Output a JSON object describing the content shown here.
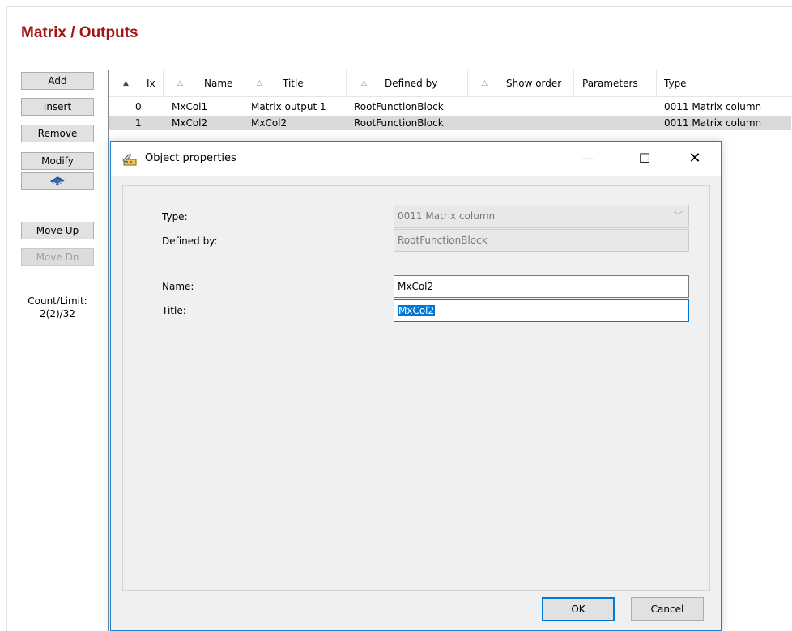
{
  "page": {
    "title": "Matrix / Outputs"
  },
  "sidebar": {
    "add_label": "Add",
    "insert_label": "Insert",
    "remove_label": "Remove",
    "modify_label": "Modify",
    "help_icon": "book-icon",
    "move_up_label": "Move Up",
    "move_dn_label": "Move Dn",
    "count_label": "Count/Limit:",
    "count_value": "2(2)/32"
  },
  "table": {
    "columns": [
      "Ix",
      "Name",
      "Title",
      "Defined by",
      "Show order",
      "Parameters",
      "Type"
    ],
    "rows": [
      {
        "ix": "0",
        "name": "MxCol1",
        "title": "Matrix output 1",
        "defined_by": "RootFunctionBlock",
        "show_order": "",
        "parameters": "",
        "type": "0011 Matrix column"
      },
      {
        "ix": "1",
        "name": "MxCol2",
        "title": "MxCol2",
        "defined_by": "RootFunctionBlock",
        "show_order": "",
        "parameters": "",
        "type": "0011 Matrix column"
      }
    ]
  },
  "dialog": {
    "title": "Object properties",
    "minimize": "—",
    "maximize": "☐",
    "close": "✕",
    "type_label": "Type:",
    "type_value": "0011  Matrix column",
    "defined_by_label": "Defined by:",
    "defined_by_value": "RootFunctionBlock",
    "name_label": "Name:",
    "name_value": "MxCol2",
    "title_label": "Title:",
    "title_value": "MxCol2",
    "ok_label": "OK",
    "cancel_label": "Cancel"
  }
}
